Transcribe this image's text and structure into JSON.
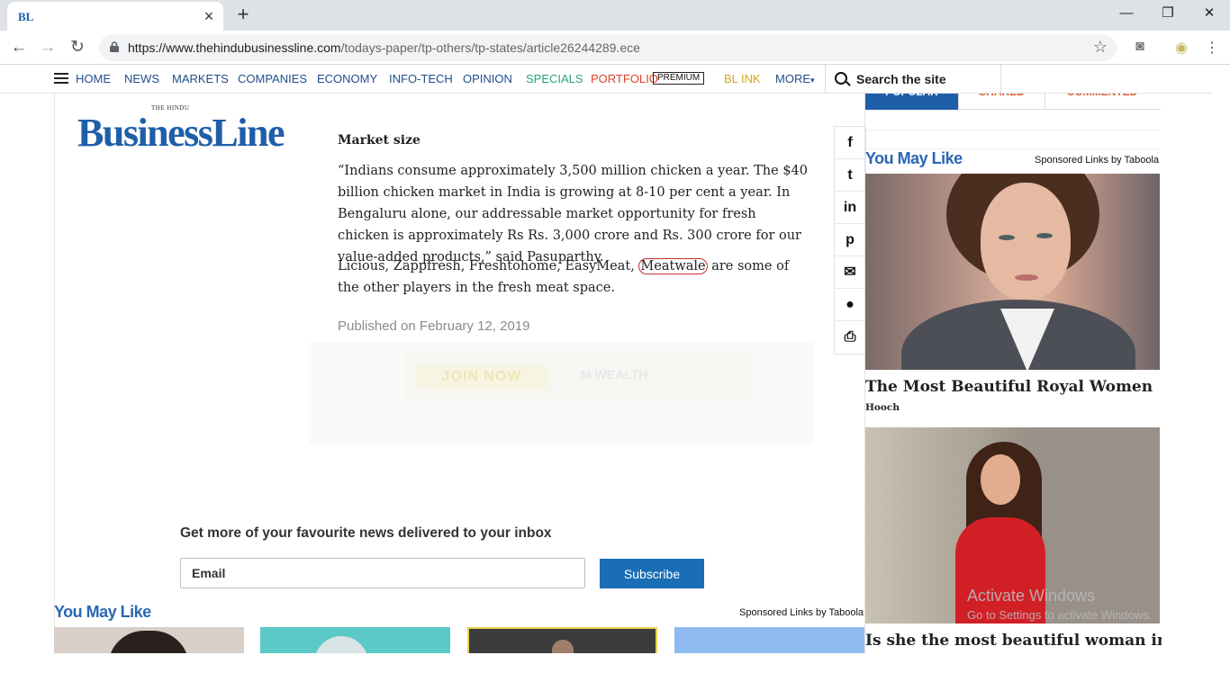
{
  "browser": {
    "tab_favicon": "BL",
    "tab_close": "×",
    "new_tab": "+",
    "url_domain": "https://www.thehindubusinessline.com",
    "url_path": "/todays-paper/tp-others/tp-states/article26244289.ece",
    "window_minimize": "—",
    "window_restore": "❐",
    "window_close": "✕",
    "back": "←",
    "forward": "→",
    "reload": "↻",
    "bookmark": "☆",
    "camera": "◙",
    "profile": "◉"
  },
  "site_nav": {
    "items": [
      "HOME",
      "NEWS",
      "MARKETS",
      "COMPANIES",
      "ECONOMY",
      "INFO-TECH",
      "OPINION",
      "SPECIALS",
      "PORTFOLIO",
      "BL INK",
      "MORE"
    ],
    "more_caret": "▾",
    "premium_badge": "PREMIUM",
    "search_placeholder": "Search the site",
    "colors": {
      "default": "#1f4e8a",
      "specials": "#2aa37a",
      "portfolio": "#e0402a",
      "blink": "#d4a520"
    }
  },
  "logo": {
    "small": "THE HINDU",
    "main": "BusinessLine"
  },
  "article": {
    "subheading": "Market size",
    "para1": "“Indians consume approximately 3,500 million chicken a year. The $40 billion chicken market in India is growing at 8-10 per cent a year. In Bengaluru alone, our addressable market opportunity for fresh chicken is approximately Rs Rs. 3,000 crore and Rs. 300 crore for our value-added products,” said Pasuparthy.",
    "para2_before": "Licious, Zappfresh, Freshtohome, EasyMeat, ",
    "para2_circled": "Meatwale",
    "para2_after": " are some of the other players in the fresh meat space.",
    "published": "Published on February 12, 2019"
  },
  "ad": {
    "button": "JOIN NOW",
    "brand": "M WEALTH"
  },
  "share_icons": [
    "f",
    "t",
    "in",
    "p",
    "✉",
    "●",
    "⎙"
  ],
  "newsletter": {
    "title": "Get more of your favourite news delivered to your inbox",
    "email_placeholder": "Email",
    "subscribe_label": "Subscribe"
  },
  "bottom_recs": {
    "title": "You May Like",
    "sponsor": "Sponsored Links by Taboola"
  },
  "rail": {
    "tabs": [
      "POPULAR",
      "SHARED",
      "COMMENTED"
    ],
    "title": "You May Like",
    "sponsor": "Sponsored Links by Taboola",
    "cards": [
      {
        "caption": "The Most Beautiful Royal Women",
        "source": "Hooch"
      },
      {
        "caption": "Is she the most beautiful woman in the"
      }
    ]
  },
  "watermark": {
    "line1": "Activate Windows",
    "line2": "Go to Settings to activate Windows."
  }
}
